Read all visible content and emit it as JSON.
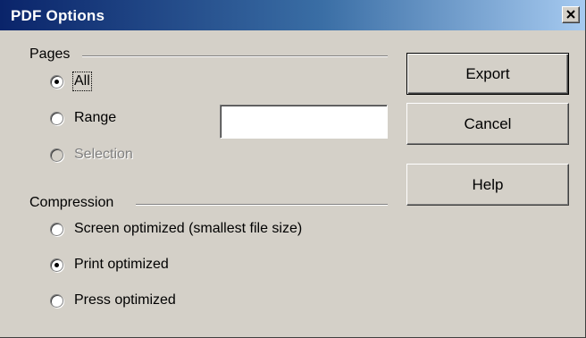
{
  "dialog": {
    "title": "PDF Options"
  },
  "pages": {
    "group_label": "Pages",
    "options": [
      {
        "label": "All",
        "selected": true,
        "enabled": true
      },
      {
        "label": "Range",
        "selected": false,
        "enabled": true
      },
      {
        "label": "Selection",
        "selected": false,
        "enabled": false
      }
    ],
    "range_value": ""
  },
  "compression": {
    "group_label": "Compression",
    "options": [
      {
        "label": "Screen optimized (smallest file size)",
        "selected": false
      },
      {
        "label": "Print optimized",
        "selected": true
      },
      {
        "label": "Press optimized",
        "selected": false
      }
    ]
  },
  "buttons": {
    "export": "Export",
    "cancel": "Cancel",
    "help": "Help"
  },
  "colors": {
    "titlebar_start": "#0a246a",
    "titlebar_end": "#a6caf0",
    "dialog_face": "#d4d0c8"
  }
}
